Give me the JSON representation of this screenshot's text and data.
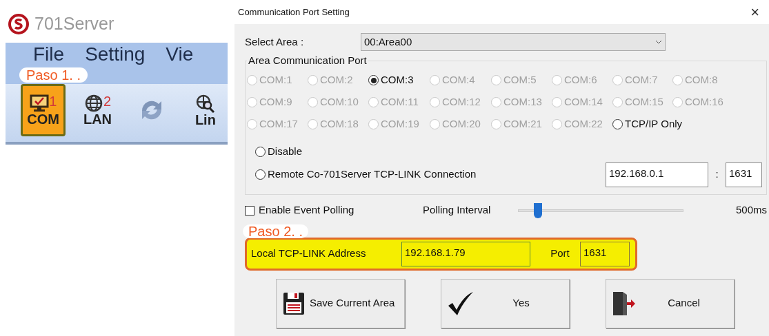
{
  "app": {
    "title": "701Server",
    "menu": [
      "File",
      "Setting",
      "Vie"
    ],
    "step_label": "Paso 1. .",
    "toolbar": [
      {
        "kind": "com",
        "label": "COM",
        "badge": "1",
        "selected": true
      },
      {
        "kind": "lan",
        "label": "LAN",
        "badge": "2",
        "selected": false
      },
      {
        "kind": "refresh",
        "selected": false
      },
      {
        "kind": "line",
        "label": "Lin",
        "selected": false
      }
    ]
  },
  "dialog": {
    "title": "Communication Port Setting",
    "close": "×",
    "select_area": {
      "label": "Select Area :",
      "value": "00:Area00"
    },
    "group_title": "Area Communication Port",
    "ports": [
      {
        "label": "COM:1",
        "selected": false,
        "disabled": true
      },
      {
        "label": "COM:2",
        "selected": false,
        "disabled": true
      },
      {
        "label": "COM:3",
        "selected": true,
        "disabled": false
      },
      {
        "label": "COM:4",
        "selected": false,
        "disabled": true
      },
      {
        "label": "COM:5",
        "selected": false,
        "disabled": true
      },
      {
        "label": "COM:6",
        "selected": false,
        "disabled": true
      },
      {
        "label": "COM:7",
        "selected": false,
        "disabled": true
      },
      {
        "label": "COM:8",
        "selected": false,
        "disabled": true
      },
      {
        "label": "COM:9",
        "selected": false,
        "disabled": true
      },
      {
        "label": "COM:10",
        "selected": false,
        "disabled": true
      },
      {
        "label": "COM:11",
        "selected": false,
        "disabled": true
      },
      {
        "label": "COM:12",
        "selected": false,
        "disabled": true
      },
      {
        "label": "COM:13",
        "selected": false,
        "disabled": true
      },
      {
        "label": "COM:14",
        "selected": false,
        "disabled": true
      },
      {
        "label": "COM:15",
        "selected": false,
        "disabled": true
      },
      {
        "label": "COM:16",
        "selected": false,
        "disabled": true
      },
      {
        "label": "COM:17",
        "selected": false,
        "disabled": true
      },
      {
        "label": "COM:18",
        "selected": false,
        "disabled": true
      },
      {
        "label": "COM:19",
        "selected": false,
        "disabled": true
      },
      {
        "label": "COM:20",
        "selected": false,
        "disabled": true
      },
      {
        "label": "COM:21",
        "selected": false,
        "disabled": true
      },
      {
        "label": "COM:22",
        "selected": false,
        "disabled": true
      },
      {
        "label": "TCP/IP Only",
        "selected": false,
        "disabled": false
      }
    ],
    "modes": [
      {
        "label": "Disable",
        "selected": false
      },
      {
        "label": "Remote Co-701Server TCP-LINK Connection",
        "selected": false
      }
    ],
    "remote_ip": "192.168.0.1",
    "remote_separator": ":",
    "remote_port": "1631",
    "event_polling": {
      "label": "Enable Event Polling",
      "checked": false
    },
    "polling_interval": {
      "label": "Polling Interval",
      "level": 0.12,
      "reading": "500ms"
    },
    "step_label": "Paso 2. .",
    "local": {
      "label": "Local TCP-LINK Address",
      "value": "192.168.1.79",
      "port_label": "Port",
      "port": "1631"
    },
    "buttons": [
      {
        "kind": "save",
        "label": "Save Current Area"
      },
      {
        "kind": "yes",
        "label": "Yes"
      },
      {
        "kind": "cancel",
        "label": "Cancel"
      }
    ]
  }
}
